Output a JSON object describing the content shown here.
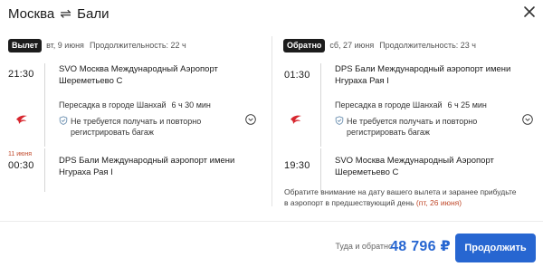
{
  "header": {
    "from": "Москва",
    "swap_icon": "⇌",
    "to": "Бали"
  },
  "outbound": {
    "badge": "Вылет",
    "date": "вт, 9 июня",
    "duration": "Продолжительность: 22 ч",
    "depart_time": "21:30",
    "depart_airport": "SVO Москва Международный Аэропорт Шереметьево С",
    "transfer_city": "Пересадка в городе Шанхай",
    "transfer_duration": "6 ч 30 мин",
    "baggage_note": "Не требуется получать и повторно регистрировать багаж",
    "arrival_date_note": "11 июня",
    "arrive_time": "00:30",
    "arrive_airport": "DPS Бали Международный аэропорт имени Нгураха Рая I"
  },
  "return": {
    "badge": "Обратно",
    "date": "сб, 27 июня",
    "duration": "Продолжительность: 23 ч",
    "depart_time": "01:30",
    "depart_airport": "DPS Бали Международный аэропорт имени Нгураха Рая I",
    "transfer_city": "Пересадка в городе Шанхай",
    "transfer_duration": "6 ч 25 мин",
    "baggage_note": "Не требуется получать и повторно регистрировать багаж",
    "arrive_time": "19:30",
    "arrive_airport": "SVO Москва Международный Аэропорт Шереметьево С"
  },
  "notice": {
    "text": "Обратите внимание на дату вашего вылета и заранее прибудьте в аэропорт в предшествующий день",
    "date_hint": "(пт, 26 июня)"
  },
  "footer": {
    "total_label": "Туда и обратно",
    "price": "48 796 ₽",
    "continue_label": "Продолжить"
  },
  "colors": {
    "accent": "#2766d1",
    "airline_red": "#d7262e",
    "warning_red": "#c0492b",
    "badge_bg": "#1c1c1c"
  }
}
